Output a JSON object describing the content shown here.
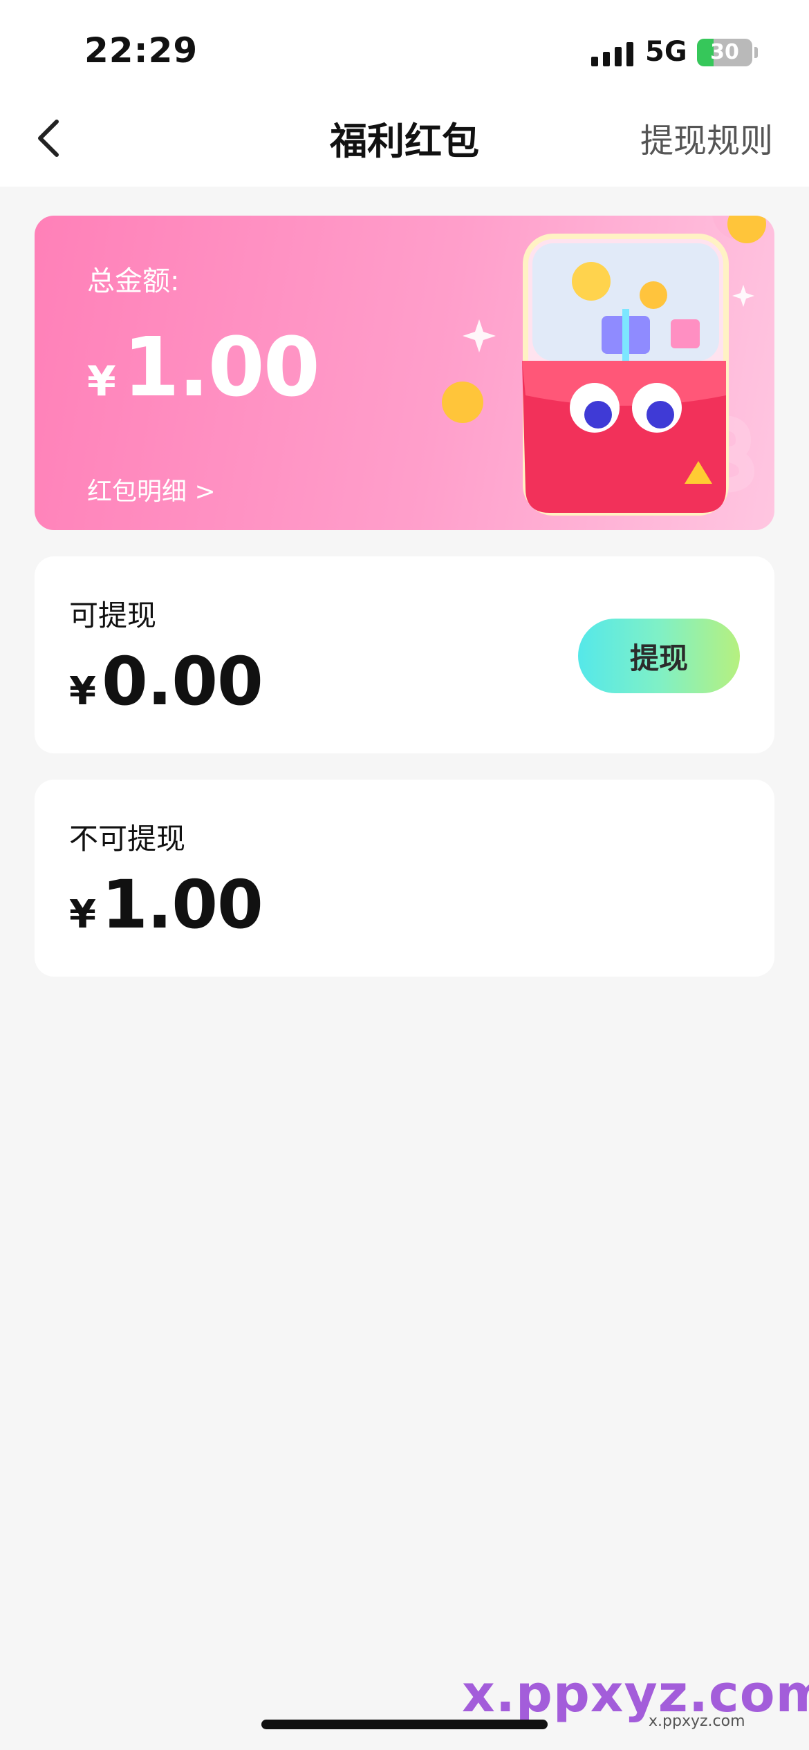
{
  "status_bar": {
    "time": "22:29",
    "network": "5G",
    "battery": "30",
    "battery_level": 0.3
  },
  "nav": {
    "title": "福利红包",
    "rules_label": "提现规则"
  },
  "total_card": {
    "label": "总金额:",
    "currency": "¥",
    "amount": "1.00",
    "detail_link": "红包明细 >"
  },
  "withdrawable": {
    "label": "可提现",
    "currency": "¥",
    "amount": "0.00",
    "button_label": "提现"
  },
  "non_withdrawable": {
    "label": "不可提现",
    "currency": "¥",
    "amount": "1.00"
  },
  "watermark": {
    "main": "x.ppxyz.com",
    "sub": "x.ppxyz.com"
  },
  "colors": {
    "accent_pink": "#ff80b8",
    "button_cyan": "#55e8e9",
    "button_green": "#b6f07f",
    "background": "#f6f6f6"
  }
}
